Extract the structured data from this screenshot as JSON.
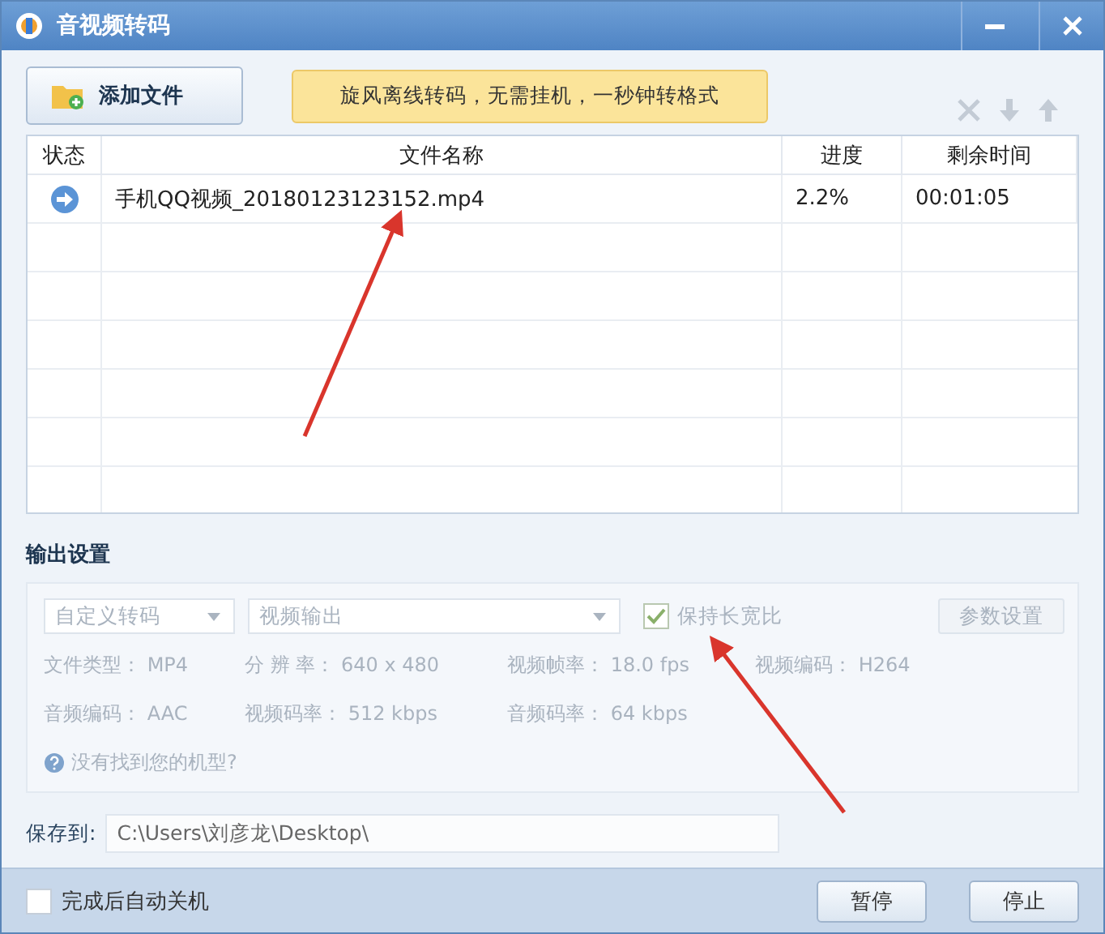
{
  "window": {
    "title": "音视频转码"
  },
  "toolbar": {
    "add_button": "添加文件",
    "banner": "旋风离线转码，无需挂机，一秒钟转格式"
  },
  "table": {
    "columns": [
      "状态",
      "文件名称",
      "进度",
      "剩余时间"
    ],
    "rows": [
      {
        "name": "手机QQ视频_20180123123152.mp4",
        "progress": "2.2%",
        "remaining": "00:01:05"
      }
    ]
  },
  "output_settings": {
    "title": "输出设置",
    "disabled": true,
    "preset": "自定义转码",
    "format": "视频输出",
    "keep_ratio": {
      "label": "保持长宽比",
      "checked": true
    },
    "params_button": "参数设置",
    "info": [
      [
        {
          "label": "文件类型：",
          "value": "MP4"
        },
        {
          "label": "分 辨 率：",
          "value": "640 x 480"
        },
        {
          "label": "视频帧率：",
          "value": "18.0 fps"
        },
        {
          "label": "视频编码：",
          "value": "H264"
        }
      ],
      [
        {
          "label": "音频编码：",
          "value": "AAC"
        },
        {
          "label": "视频码率：",
          "value": "512 kbps"
        },
        {
          "label": "音频码率：",
          "value": "64 kbps"
        }
      ]
    ],
    "help_link": "没有找到您的机型?"
  },
  "save": {
    "label": "保存到:",
    "path": "C:\\Users\\刘彦龙\\Desktop\\"
  },
  "footer": {
    "shutdown": {
      "label": "完成后自动关机",
      "checked": false
    },
    "buttons": [
      "暂停",
      "停止"
    ]
  },
  "annotations": [
    {
      "kind": "arrow"
    },
    {
      "kind": "arrow"
    }
  ]
}
